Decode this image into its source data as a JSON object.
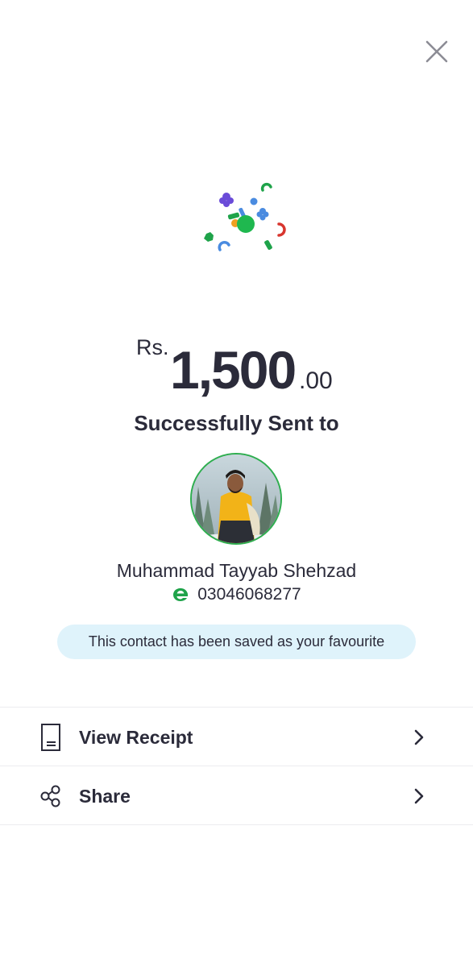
{
  "header": {
    "close_icon": "close-icon"
  },
  "amount": {
    "currency": "Rs.",
    "whole": "1,500",
    "decimal": ".00"
  },
  "status": {
    "title": "Successfully Sent to"
  },
  "recipient": {
    "name": "Muhammad Tayyab Shehzad",
    "wallet_icon": "easypaisa-logo-icon",
    "phone": "03046068277",
    "accent_color": "#2eae4f"
  },
  "favourite": {
    "message": "This contact has been saved as your favourite",
    "background": "#dff3fb"
  },
  "menu": {
    "items": [
      {
        "label": "View Receipt",
        "icon": "receipt-icon"
      },
      {
        "label": "Share",
        "icon": "share-icon"
      }
    ]
  }
}
